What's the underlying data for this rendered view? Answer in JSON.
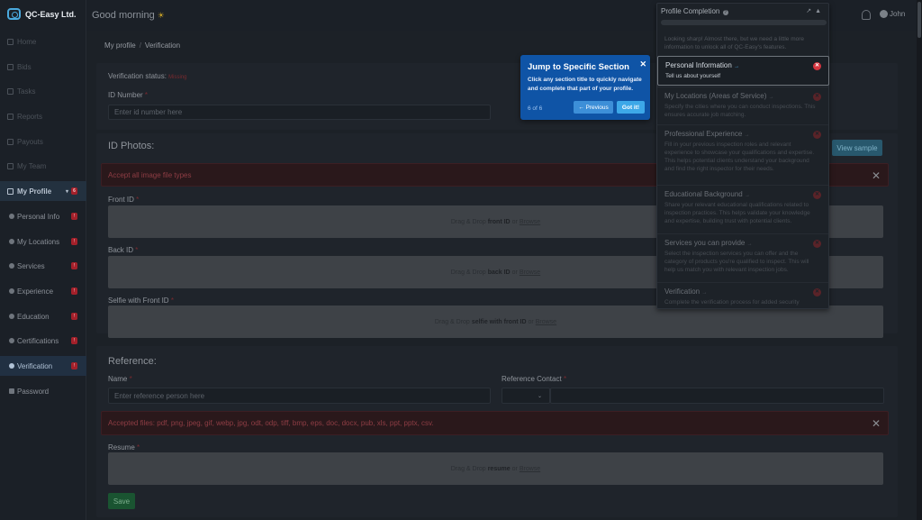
{
  "app": {
    "brand": "QC-Easy Ltd."
  },
  "sidebar": {
    "items": [
      {
        "label": "Home"
      },
      {
        "label": "Bids"
      },
      {
        "label": "Tasks"
      },
      {
        "label": "Reports"
      },
      {
        "label": "Payouts"
      },
      {
        "label": "My Team"
      }
    ],
    "profile": {
      "label": "My Profile",
      "badge": "6"
    },
    "sub_items": [
      {
        "label": "Personal Info",
        "badge": "!"
      },
      {
        "label": "My Locations",
        "badge": "!"
      },
      {
        "label": "Services",
        "badge": "!"
      },
      {
        "label": "Experience",
        "badge": "!"
      },
      {
        "label": "Education",
        "badge": "!"
      },
      {
        "label": "Certifications",
        "badge": "!"
      },
      {
        "label": "Verification",
        "badge": "!"
      },
      {
        "label": "Password",
        "badge": ""
      }
    ]
  },
  "header": {
    "greeting": "Good morning",
    "user_name": "John"
  },
  "breadcrumb": {
    "parent": "My profile",
    "separator": "/",
    "current": "Verification"
  },
  "verification": {
    "status_label": "Verification status:",
    "status_value": "Missing",
    "id_label": "ID Number",
    "id_placeholder": "Enter id number here"
  },
  "photos": {
    "heading": "ID Photos:",
    "view_sample": "View sample",
    "alert": "Accept all image file types",
    "front_label": "Front ID",
    "back_label": "Back ID",
    "selfie_label": "Selfie with Front ID",
    "drag_text": "Drag & Drop",
    "or_text": "or",
    "browse": "Browse",
    "front_bold": "front ID",
    "back_bold": "back ID",
    "selfie_bold": "selfie with front ID"
  },
  "reference": {
    "heading": "Reference:",
    "name_label": "Name",
    "name_placeholder": "Enter reference person here",
    "contact_label": "Reference Contact",
    "alert": "Accepted files: pdf, png, jpeg, gif, webp, jpg, odt, odp, tiff, bmp, eps, doc, docx, pub, xls, ppt, pptx, csv.",
    "resume_label": "Resume",
    "resume_bold": "resume",
    "save": "Save"
  },
  "completion": {
    "title": "Profile Completion",
    "intro": "Looking sharp! Almost there, but we need a little more information to unlock all of QC-Easy's features.",
    "sections": [
      {
        "title": "Personal Information",
        "desc": "Tell us about yourself"
      },
      {
        "title": "My Locations (Areas of Service)",
        "desc": "Specify the cities where you can conduct inspections. This ensures accurate job matching."
      },
      {
        "title": "Professional Experience",
        "desc": "Fill in your previous inspection roles and relevant experience to showcase your qualifications and expertise. This helps potential clients understand your background and find the right inspector for their needs."
      },
      {
        "title": "Educational Background",
        "desc": "Share your relevant educational qualifications related to inspection practices. This helps validate your knowledge and expertise, building trust with potential clients."
      },
      {
        "title": "Services you can provide",
        "desc": "Select the inspection services you can offer and the category of products you're qualified to inspect. This will help us match you with relevant inspection jobs."
      },
      {
        "title": "Verification",
        "desc": "Complete the verification process for added security"
      }
    ]
  },
  "tour": {
    "title": "Jump to Specific Section",
    "text": "Click any section title to quickly navigate and complete that part of your profile.",
    "steps": "6 of 6",
    "previous": "← Previous",
    "got_it": "Got it!",
    "close": "✕"
  }
}
